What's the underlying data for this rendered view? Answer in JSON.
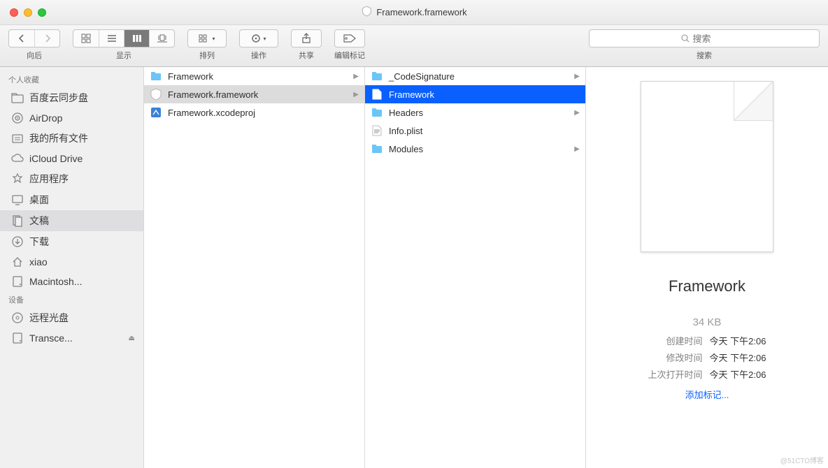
{
  "title": "Framework.framework",
  "toolbar": {
    "back_label": "向后",
    "view_label": "显示",
    "arrange_label": "排列",
    "action_label": "操作",
    "share_label": "共享",
    "tags_label": "编辑标记",
    "search_label": "搜索",
    "search_placeholder": "搜索"
  },
  "sidebar": {
    "sections": [
      {
        "header": "个人收藏",
        "items": [
          {
            "icon": "folder",
            "label": "百度云同步盘"
          },
          {
            "icon": "airdrop",
            "label": "AirDrop"
          },
          {
            "icon": "allfiles",
            "label": "我的所有文件"
          },
          {
            "icon": "icloud",
            "label": "iCloud Drive"
          },
          {
            "icon": "apps",
            "label": "应用程序"
          },
          {
            "icon": "desktop",
            "label": "桌面"
          },
          {
            "icon": "docs",
            "label": "文稿",
            "selected": true
          },
          {
            "icon": "download",
            "label": "下载"
          },
          {
            "icon": "home",
            "label": "xiao"
          },
          {
            "icon": "hdd",
            "label": "Macintosh..."
          }
        ]
      },
      {
        "header": "设备",
        "items": [
          {
            "icon": "disc",
            "label": "远程光盘"
          },
          {
            "icon": "hdd",
            "label": "Transce...",
            "eject": true
          }
        ]
      }
    ]
  },
  "columns": {
    "c1": [
      {
        "type": "folder",
        "label": "Framework",
        "hasChildren": true
      },
      {
        "type": "framework",
        "label": "Framework.framework",
        "hasChildren": true,
        "selected": "gray"
      },
      {
        "type": "xcode",
        "label": "Framework.xcodeproj",
        "hasChildren": false
      }
    ],
    "c2": [
      {
        "type": "folder",
        "label": "_CodeSignature",
        "hasChildren": true
      },
      {
        "type": "exec",
        "label": "Framework",
        "hasChildren": false,
        "selected": "blue"
      },
      {
        "type": "folder",
        "label": "Headers",
        "hasChildren": true
      },
      {
        "type": "plist",
        "label": "Info.plist",
        "hasChildren": false
      },
      {
        "type": "folder",
        "label": "Modules",
        "hasChildren": true
      }
    ]
  },
  "preview": {
    "name": "Framework",
    "size": "34 KB",
    "meta": [
      {
        "k": "创建时间",
        "v": "今天 下午2:06"
      },
      {
        "k": "修改时间",
        "v": "今天 下午2:06"
      },
      {
        "k": "上次打开时间",
        "v": "今天 下午2:06"
      }
    ],
    "add_tags": "添加标记..."
  },
  "watermark": "@51CTO博客"
}
